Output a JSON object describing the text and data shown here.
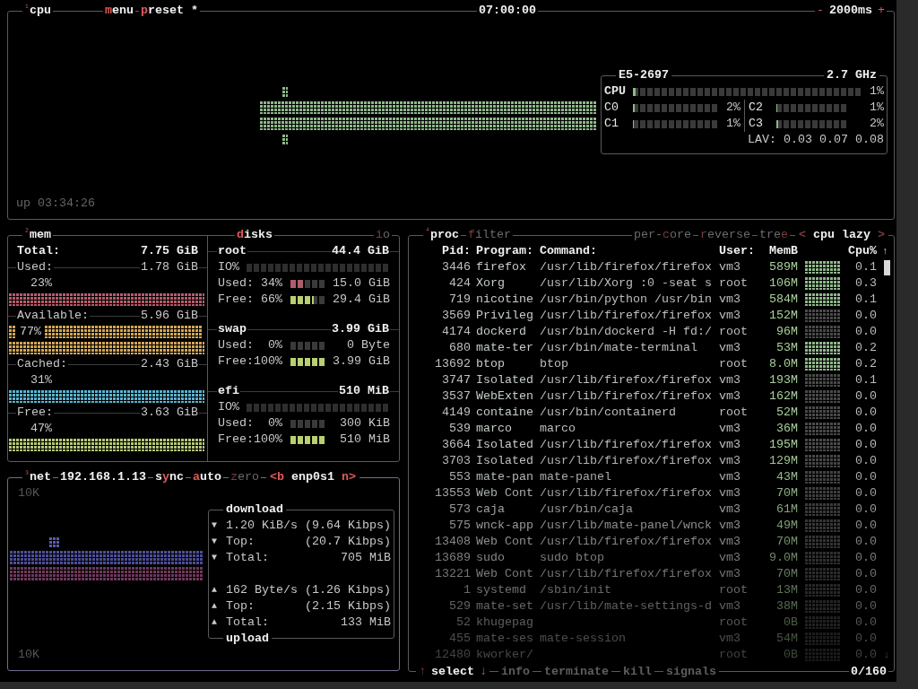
{
  "cpu_panel": {
    "index": "¹",
    "title": "cpu",
    "menu": {
      "key": "m",
      "after": "enu"
    },
    "preset": {
      "key": "p",
      "after": "reset",
      "mark": "*"
    },
    "clock": "07:00:00",
    "interval_down": "-",
    "interval": "2000ms",
    "interval_up": "+",
    "cpu_info": {
      "model": "E5-2697",
      "frequency": "2.7 GHz",
      "total": {
        "label": "CPU",
        "level": 0.01,
        "reading": "1%"
      },
      "cores": [
        {
          "label": "C0",
          "level": 0.02,
          "reading": "2%"
        },
        {
          "label": "C2",
          "level": 0.01,
          "reading": "1%"
        },
        {
          "label": "C1",
          "level": 0.01,
          "reading": "1%"
        },
        {
          "label": "C3",
          "level": 0.02,
          "reading": "2%"
        }
      ],
      "load_average": "LAV: 0.03 0.07 0.08"
    },
    "uptime": "up 03:34:26"
  },
  "mem_panel": {
    "index": "²",
    "title": "mem",
    "total": {
      "label": "Total:",
      "value": "7.75 GiB"
    },
    "stats": [
      {
        "label": "Used:",
        "value": "1.78 GiB",
        "percent": "23%",
        "kind": "single",
        "color": "#b85c6c"
      },
      {
        "label": "Available:",
        "value": "5.96 GiB",
        "percent": "77%",
        "kind": "double",
        "color": "#d4a552"
      },
      {
        "label": "Cached:",
        "value": "2.43 GiB",
        "percent": "31%",
        "kind": "single",
        "color": "#5ab4d0"
      },
      {
        "label": "Free:",
        "value": "3.63 GiB",
        "percent": "47%",
        "kind": "single",
        "color": "#b4c878"
      }
    ]
  },
  "disks_panel": {
    "title": {
      "key": "d",
      "after": "isks"
    },
    "io_toggle": {
      "key": "i",
      "after": "o",
      "on": false
    },
    "disks": [
      {
        "name": "root",
        "size": "44.4 GiB",
        "io": {
          "label": "IO%",
          "level": 0
        },
        "used": {
          "label": "Used:",
          "percent": "34%",
          "level": 0.34,
          "value": "15.0 GiB"
        },
        "free": {
          "label": "Free:",
          "percent": "66%",
          "level": 0.66,
          "value": "29.4 GiB"
        }
      },
      {
        "name": "swap",
        "size": "3.99 GiB",
        "used": {
          "label": "Used:",
          "percent": "0%",
          "level": 0,
          "value": "0 Byte"
        },
        "free": {
          "label": "Free:",
          "percent": "100%",
          "level": 1,
          "value": "3.99 GiB"
        }
      },
      {
        "name": "efi",
        "size": "510 MiB",
        "io": {
          "label": "IO%",
          "level": 0
        },
        "used": {
          "label": "Used:",
          "percent": "0%",
          "level": 0,
          "value": "300 KiB"
        },
        "free": {
          "label": "Free:",
          "percent": "100%",
          "level": 1,
          "value": "510 MiB"
        }
      }
    ]
  },
  "net_panel": {
    "index": "³",
    "title": "net",
    "address": "192.168.1.13",
    "toggles": [
      {
        "before": "s",
        "key": "y",
        "after": "nc",
        "on": true
      },
      {
        "key": "a",
        "after": "uto",
        "on": true
      },
      {
        "key": "z",
        "after": "ero",
        "on": false
      }
    ],
    "prev": "<b",
    "interface": "enp0s1",
    "next": "n>",
    "scale_top": "10K",
    "scale_bottom": "10K",
    "download": {
      "title": "download",
      "arrow": "▼",
      "rate": "1.20 KiB/s",
      "rate_bits": "(9.64 Kibps)",
      "top_label": "Top:",
      "top": "(20.7 Kibps)",
      "total_label": "Total:",
      "total": "705 MiB"
    },
    "upload": {
      "title": "upload",
      "arrow": "▲",
      "rate": "162 Byte/s",
      "rate_bits": "(1.26 Kibps)",
      "top_label": "Top:",
      "top": "(2.15 Kibps)",
      "total_label": "Total:",
      "total": "133 MiB"
    }
  },
  "proc_panel": {
    "index": "⁴",
    "title": "proc",
    "filter": {
      "key": "f",
      "after": "ilter",
      "on": false
    },
    "toggles": [
      {
        "before": "per-",
        "key": "c",
        "after": "ore",
        "on": false
      },
      {
        "key": "r",
        "after": "everse",
        "on": false
      },
      {
        "before": "tre",
        "key": "e",
        "on": false
      }
    ],
    "sort_prev": "<",
    "sort": "cpu lazy",
    "sort_next": ">",
    "columns": [
      "Pid:",
      "Program:",
      "Command:",
      "User:",
      "MemB",
      "Cpu%"
    ],
    "scroll_up": "↑",
    "scroll_down": "↓",
    "rows": [
      {
        "pid": "3446",
        "program": "firefox",
        "command": "/usr/lib/firefox/firefox",
        "user": "vm3",
        "mem": "589M",
        "cpu": "0.1"
      },
      {
        "pid": "424",
        "program": "Xorg",
        "command": "/usr/lib/Xorg :0 -seat s",
        "user": "root",
        "mem": "106M",
        "cpu": "0.3"
      },
      {
        "pid": "719",
        "program": "nicotine",
        "command": "/usr/bin/python /usr/bin",
        "user": "vm3",
        "mem": "584M",
        "cpu": "0.1"
      },
      {
        "pid": "3569",
        "program": "Privileg",
        "command": "/usr/lib/firefox/firefox",
        "user": "vm3",
        "mem": "152M",
        "cpu": "0.0"
      },
      {
        "pid": "4174",
        "program": "dockerd",
        "command": "/usr/bin/dockerd -H fd:/",
        "user": "root",
        "mem": "96M",
        "cpu": "0.0"
      },
      {
        "pid": "680",
        "program": "mate-ter",
        "command": "/usr/bin/mate-terminal",
        "user": "vm3",
        "mem": "53M",
        "cpu": "0.2"
      },
      {
        "pid": "13692",
        "program": "btop",
        "command": "btop",
        "user": "root",
        "mem": "8.0M",
        "cpu": "0.2"
      },
      {
        "pid": "3747",
        "program": "Isolated",
        "command": "/usr/lib/firefox/firefox",
        "user": "vm3",
        "mem": "193M",
        "cpu": "0.1"
      },
      {
        "pid": "3537",
        "program": "WebExten",
        "command": "/usr/lib/firefox/firefox",
        "user": "vm3",
        "mem": "162M",
        "cpu": "0.0"
      },
      {
        "pid": "4149",
        "program": "containe",
        "command": "/usr/bin/containerd",
        "user": "root",
        "mem": "52M",
        "cpu": "0.0"
      },
      {
        "pid": "539",
        "program": "marco",
        "command": "marco",
        "user": "vm3",
        "mem": "36M",
        "cpu": "0.0"
      },
      {
        "pid": "3664",
        "program": "Isolated",
        "command": "/usr/lib/firefox/firefox",
        "user": "vm3",
        "mem": "195M",
        "cpu": "0.0"
      },
      {
        "pid": "3703",
        "program": "Isolated",
        "command": "/usr/lib/firefox/firefox",
        "user": "vm3",
        "mem": "129M",
        "cpu": "0.0"
      },
      {
        "pid": "553",
        "program": "mate-pan",
        "command": "mate-panel",
        "user": "vm3",
        "mem": "43M",
        "cpu": "0.0"
      },
      {
        "pid": "13553",
        "program": "Web Cont",
        "command": "/usr/lib/firefox/firefox",
        "user": "vm3",
        "mem": "70M",
        "cpu": "0.0"
      },
      {
        "pid": "573",
        "program": "caja",
        "command": "/usr/bin/caja",
        "user": "vm3",
        "mem": "61M",
        "cpu": "0.0"
      },
      {
        "pid": "575",
        "program": "wnck-app",
        "command": "/usr/lib/mate-panel/wnck",
        "user": "vm3",
        "mem": "49M",
        "cpu": "0.0"
      },
      {
        "pid": "13408",
        "program": "Web Cont",
        "command": "/usr/lib/firefox/firefox",
        "user": "vm3",
        "mem": "70M",
        "cpu": "0.0"
      },
      {
        "pid": "13689",
        "program": "sudo",
        "command": "sudo btop",
        "user": "vm3",
        "mem": "9.0M",
        "cpu": "0.0"
      },
      {
        "pid": "13221",
        "program": "Web Cont",
        "command": "/usr/lib/firefox/firefox",
        "user": "vm3",
        "mem": "70M",
        "cpu": "0.0"
      },
      {
        "pid": "1",
        "program": "systemd",
        "command": "/sbin/init",
        "user": "root",
        "mem": "13M",
        "cpu": "0.0"
      },
      {
        "pid": "529",
        "program": "mate-set",
        "command": "/usr/lib/mate-settings-d",
        "user": "vm3",
        "mem": "38M",
        "cpu": "0.0"
      },
      {
        "pid": "52",
        "program": "khugepag",
        "user": "root",
        "mem": "0B",
        "cpu": "0.0"
      },
      {
        "pid": "455",
        "program": "mate-ses",
        "command": "mate-session",
        "user": "vm3",
        "mem": "54M",
        "cpu": "0.0"
      },
      {
        "pid": "12480",
        "program": "kworker/",
        "user": "root",
        "mem": "0B",
        "cpu": "0.0"
      }
    ],
    "footer": {
      "up": "↑",
      "select": "select",
      "down": "↓",
      "actions": [
        "info",
        "terminate",
        "kill",
        "signals"
      ],
      "count": "0/160"
    }
  }
}
